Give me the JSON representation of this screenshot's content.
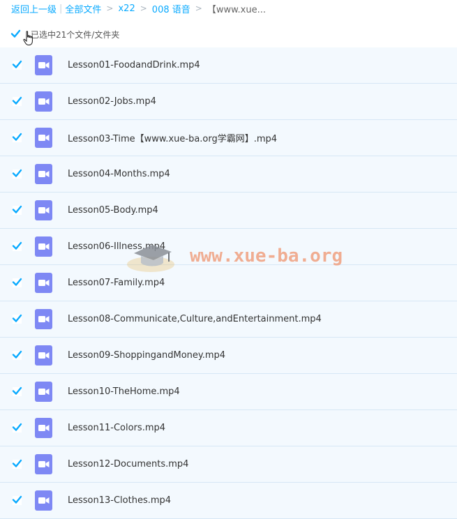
{
  "breadcrumb": {
    "back": "返回上一级",
    "all_files": "全部文件",
    "folder1": "x22",
    "folder2": "008 语音",
    "current": "【www.xue..."
  },
  "selection": {
    "label": "已选中21个文件/文件夹",
    "checked": true
  },
  "files": [
    {
      "name": "Lesson01-FoodandDrink.mp4",
      "checked": true
    },
    {
      "name": "Lesson02-Jobs.mp4",
      "checked": true
    },
    {
      "name": "Lesson03-Time【www.xue-ba.org学霸网】.mp4",
      "checked": true
    },
    {
      "name": "Lesson04-Months.mp4",
      "checked": true
    },
    {
      "name": "Lesson05-Body.mp4",
      "checked": true
    },
    {
      "name": "Lesson06-Illness.mp4",
      "checked": true
    },
    {
      "name": "Lesson07-Family.mp4",
      "checked": true
    },
    {
      "name": "Lesson08-Communicate,Culture,andEntertainment.mp4",
      "checked": true
    },
    {
      "name": "Lesson09-ShoppingandMoney.mp4",
      "checked": true
    },
    {
      "name": "Lesson10-TheHome.mp4",
      "checked": true
    },
    {
      "name": "Lesson11-Colors.mp4",
      "checked": true
    },
    {
      "name": "Lesson12-Documents.mp4",
      "checked": true
    },
    {
      "name": "Lesson13-Clothes.mp4",
      "checked": true
    }
  ],
  "watermark": {
    "text": "www.xue-ba.org"
  },
  "colors": {
    "link": "#09aaff",
    "row_bg": "#f3f9fe",
    "row_border": "#d6e7f5",
    "check": "#09aaff",
    "video_icon": "#7e88f4",
    "watermark": "#f0a080"
  },
  "icons": {
    "checkbox": "checkmark-icon",
    "file": "video-file-icon",
    "cursor": "hand-pointer-icon"
  }
}
